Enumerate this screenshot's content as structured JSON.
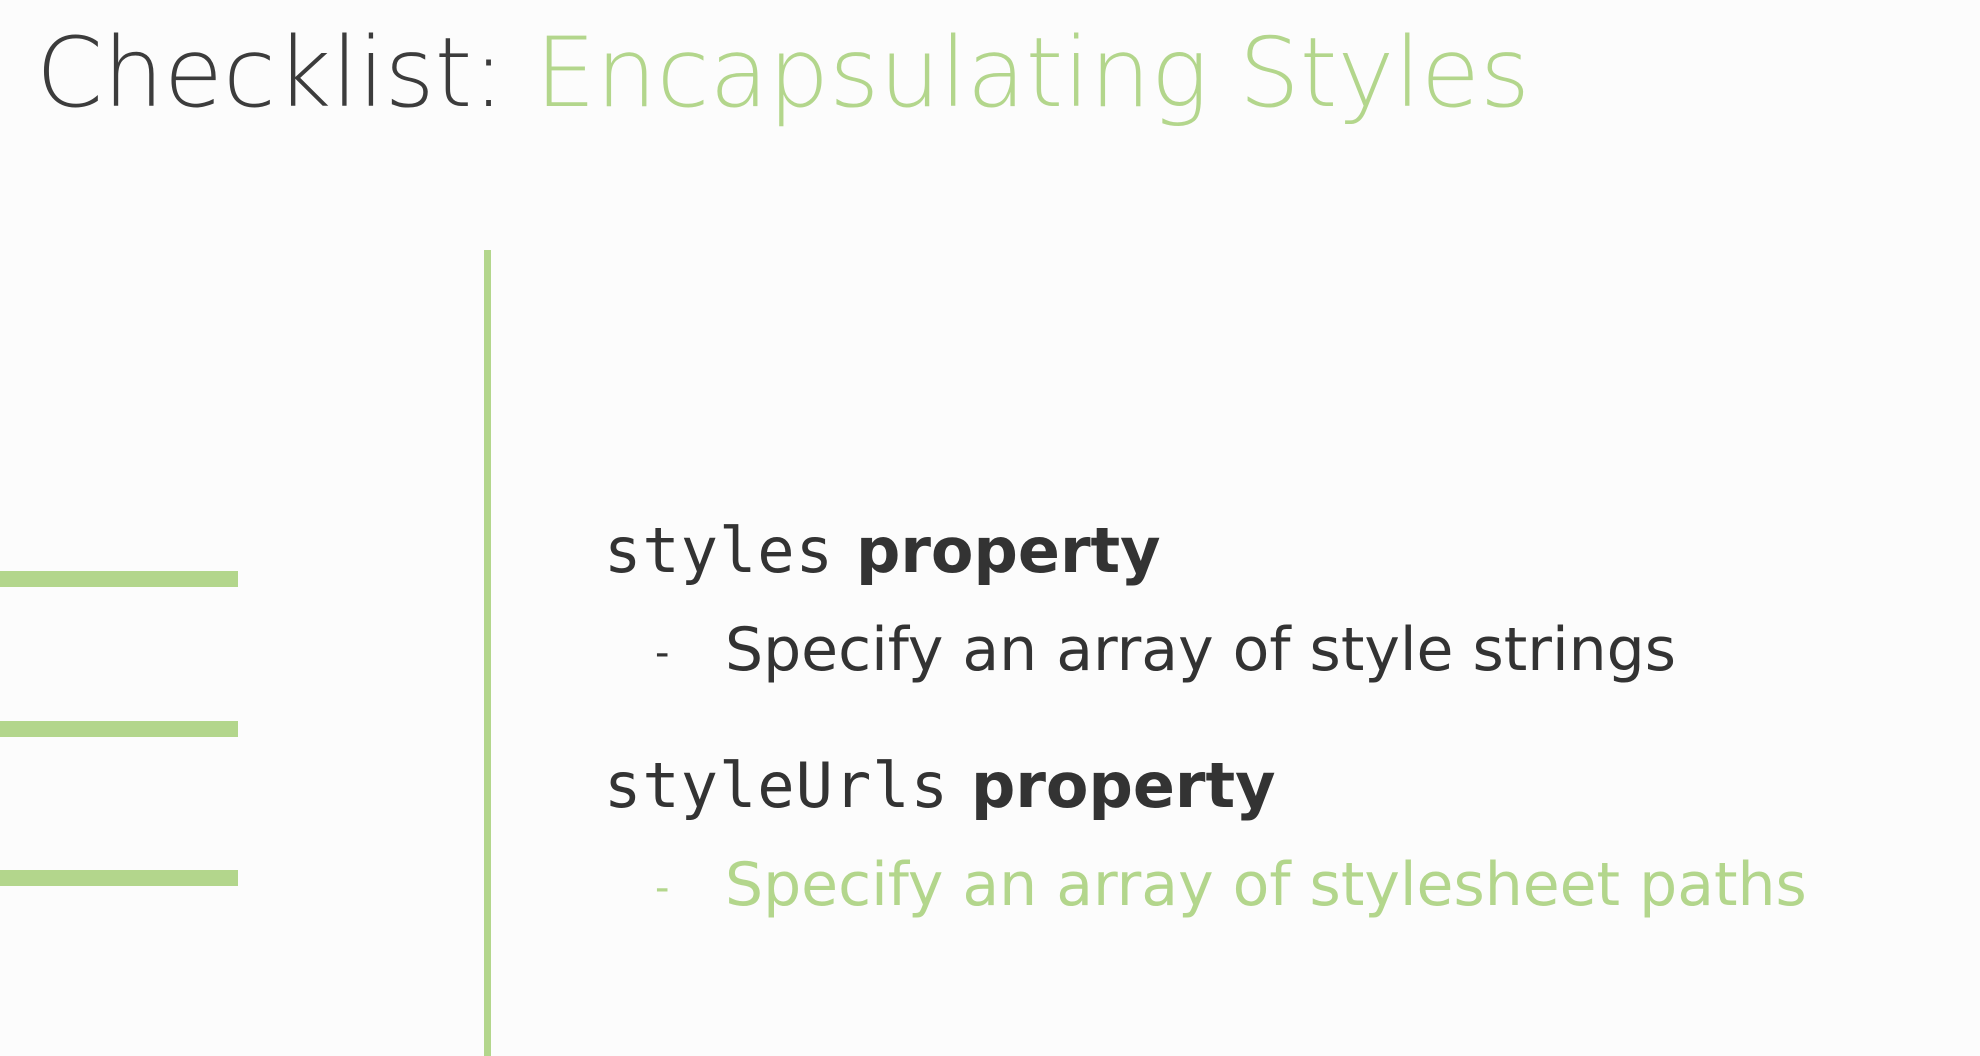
{
  "title": {
    "main": "Checklist:",
    "accent": "Encapsulating Styles"
  },
  "items": [
    {
      "code": "styles",
      "keyword": "property",
      "bullet": "-",
      "description": "Specify an array of style strings"
    },
    {
      "code": "styleUrls",
      "keyword": "property",
      "bullet": "-",
      "description": "Specify an array of stylesheet paths"
    }
  ],
  "colors": {
    "accent": "#b3d68c",
    "text": "#333333",
    "background": "#fcfcfc"
  }
}
